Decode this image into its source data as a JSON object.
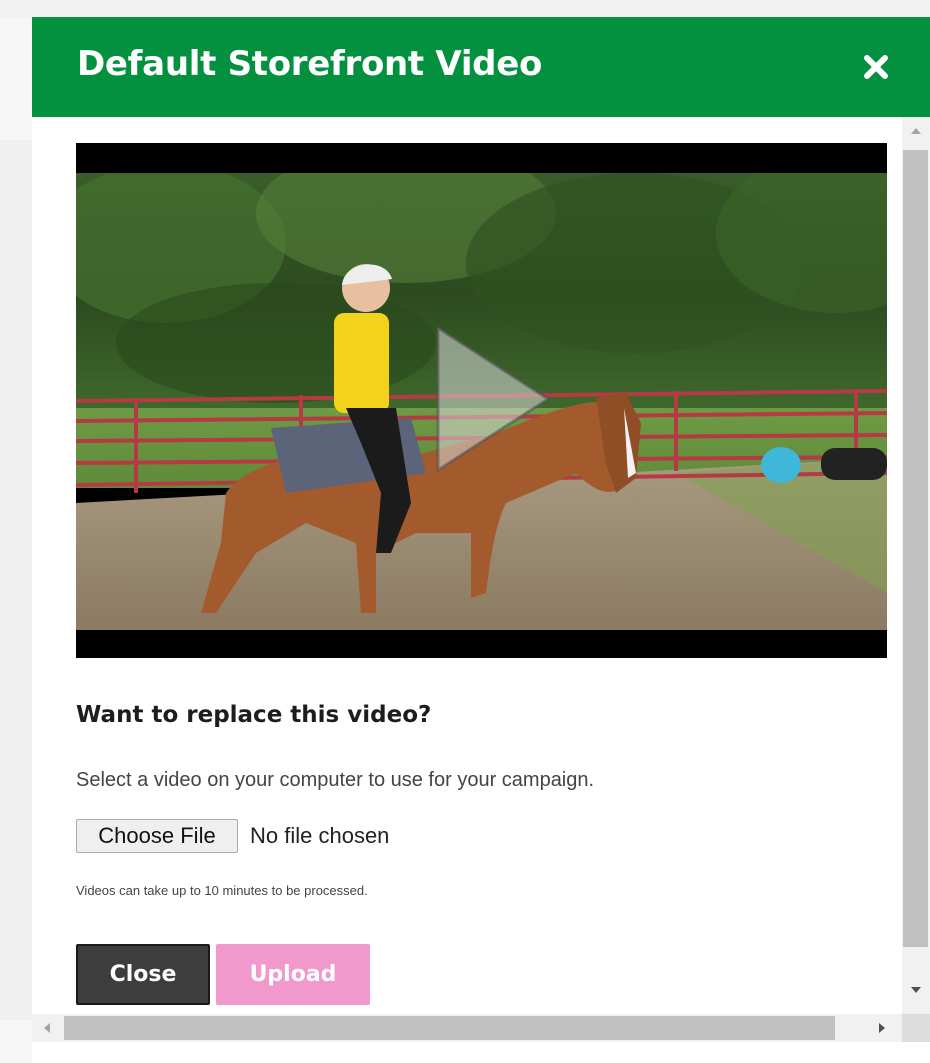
{
  "modal": {
    "title": "Default Storefront Video",
    "close_icon": "close-x-icon"
  },
  "video": {
    "thumbnail_icon": "play-icon"
  },
  "replace": {
    "heading": "Want to replace this video?",
    "instruction": "Select a video on your computer to use for your campaign.",
    "choose_file_label": "Choose File",
    "file_status": "No file chosen",
    "processing_note": "Videos can take up to 10 minutes to be processed."
  },
  "actions": {
    "close_label": "Close",
    "upload_label": "Upload"
  },
  "colors": {
    "header": "#03903f",
    "close_button": "#3d3d3d",
    "upload_button_disabled": "#f198cc"
  }
}
